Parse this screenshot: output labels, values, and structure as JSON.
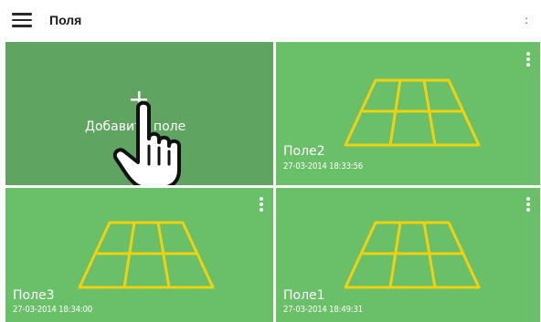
{
  "app": {
    "title": "Поля",
    "menu_icon": "hamburger-menu-icon",
    "overflow_icon": "more-vertical-icon",
    "overflow_glyph": ":"
  },
  "colors": {
    "tile_green": "#6abf69",
    "add_tile_green": "#5fa561",
    "field_outline": "#f2d20f",
    "text_white": "#ffffff"
  },
  "add_tile": {
    "label": "Добавить поле",
    "plus_icon": "plus-icon",
    "cursor_icon": "hand-pointer-icon"
  },
  "fields": [
    {
      "name": "Поле2",
      "date": "27-03-2014 18:33:56",
      "icon": "field-grid-icon"
    },
    {
      "name": "Поле3",
      "date": "27-03-2014 18:34:00",
      "icon": "field-grid-icon"
    },
    {
      "name": "Поле1",
      "date": "27-03-2014 18:49:31",
      "icon": "field-grid-icon"
    }
  ]
}
